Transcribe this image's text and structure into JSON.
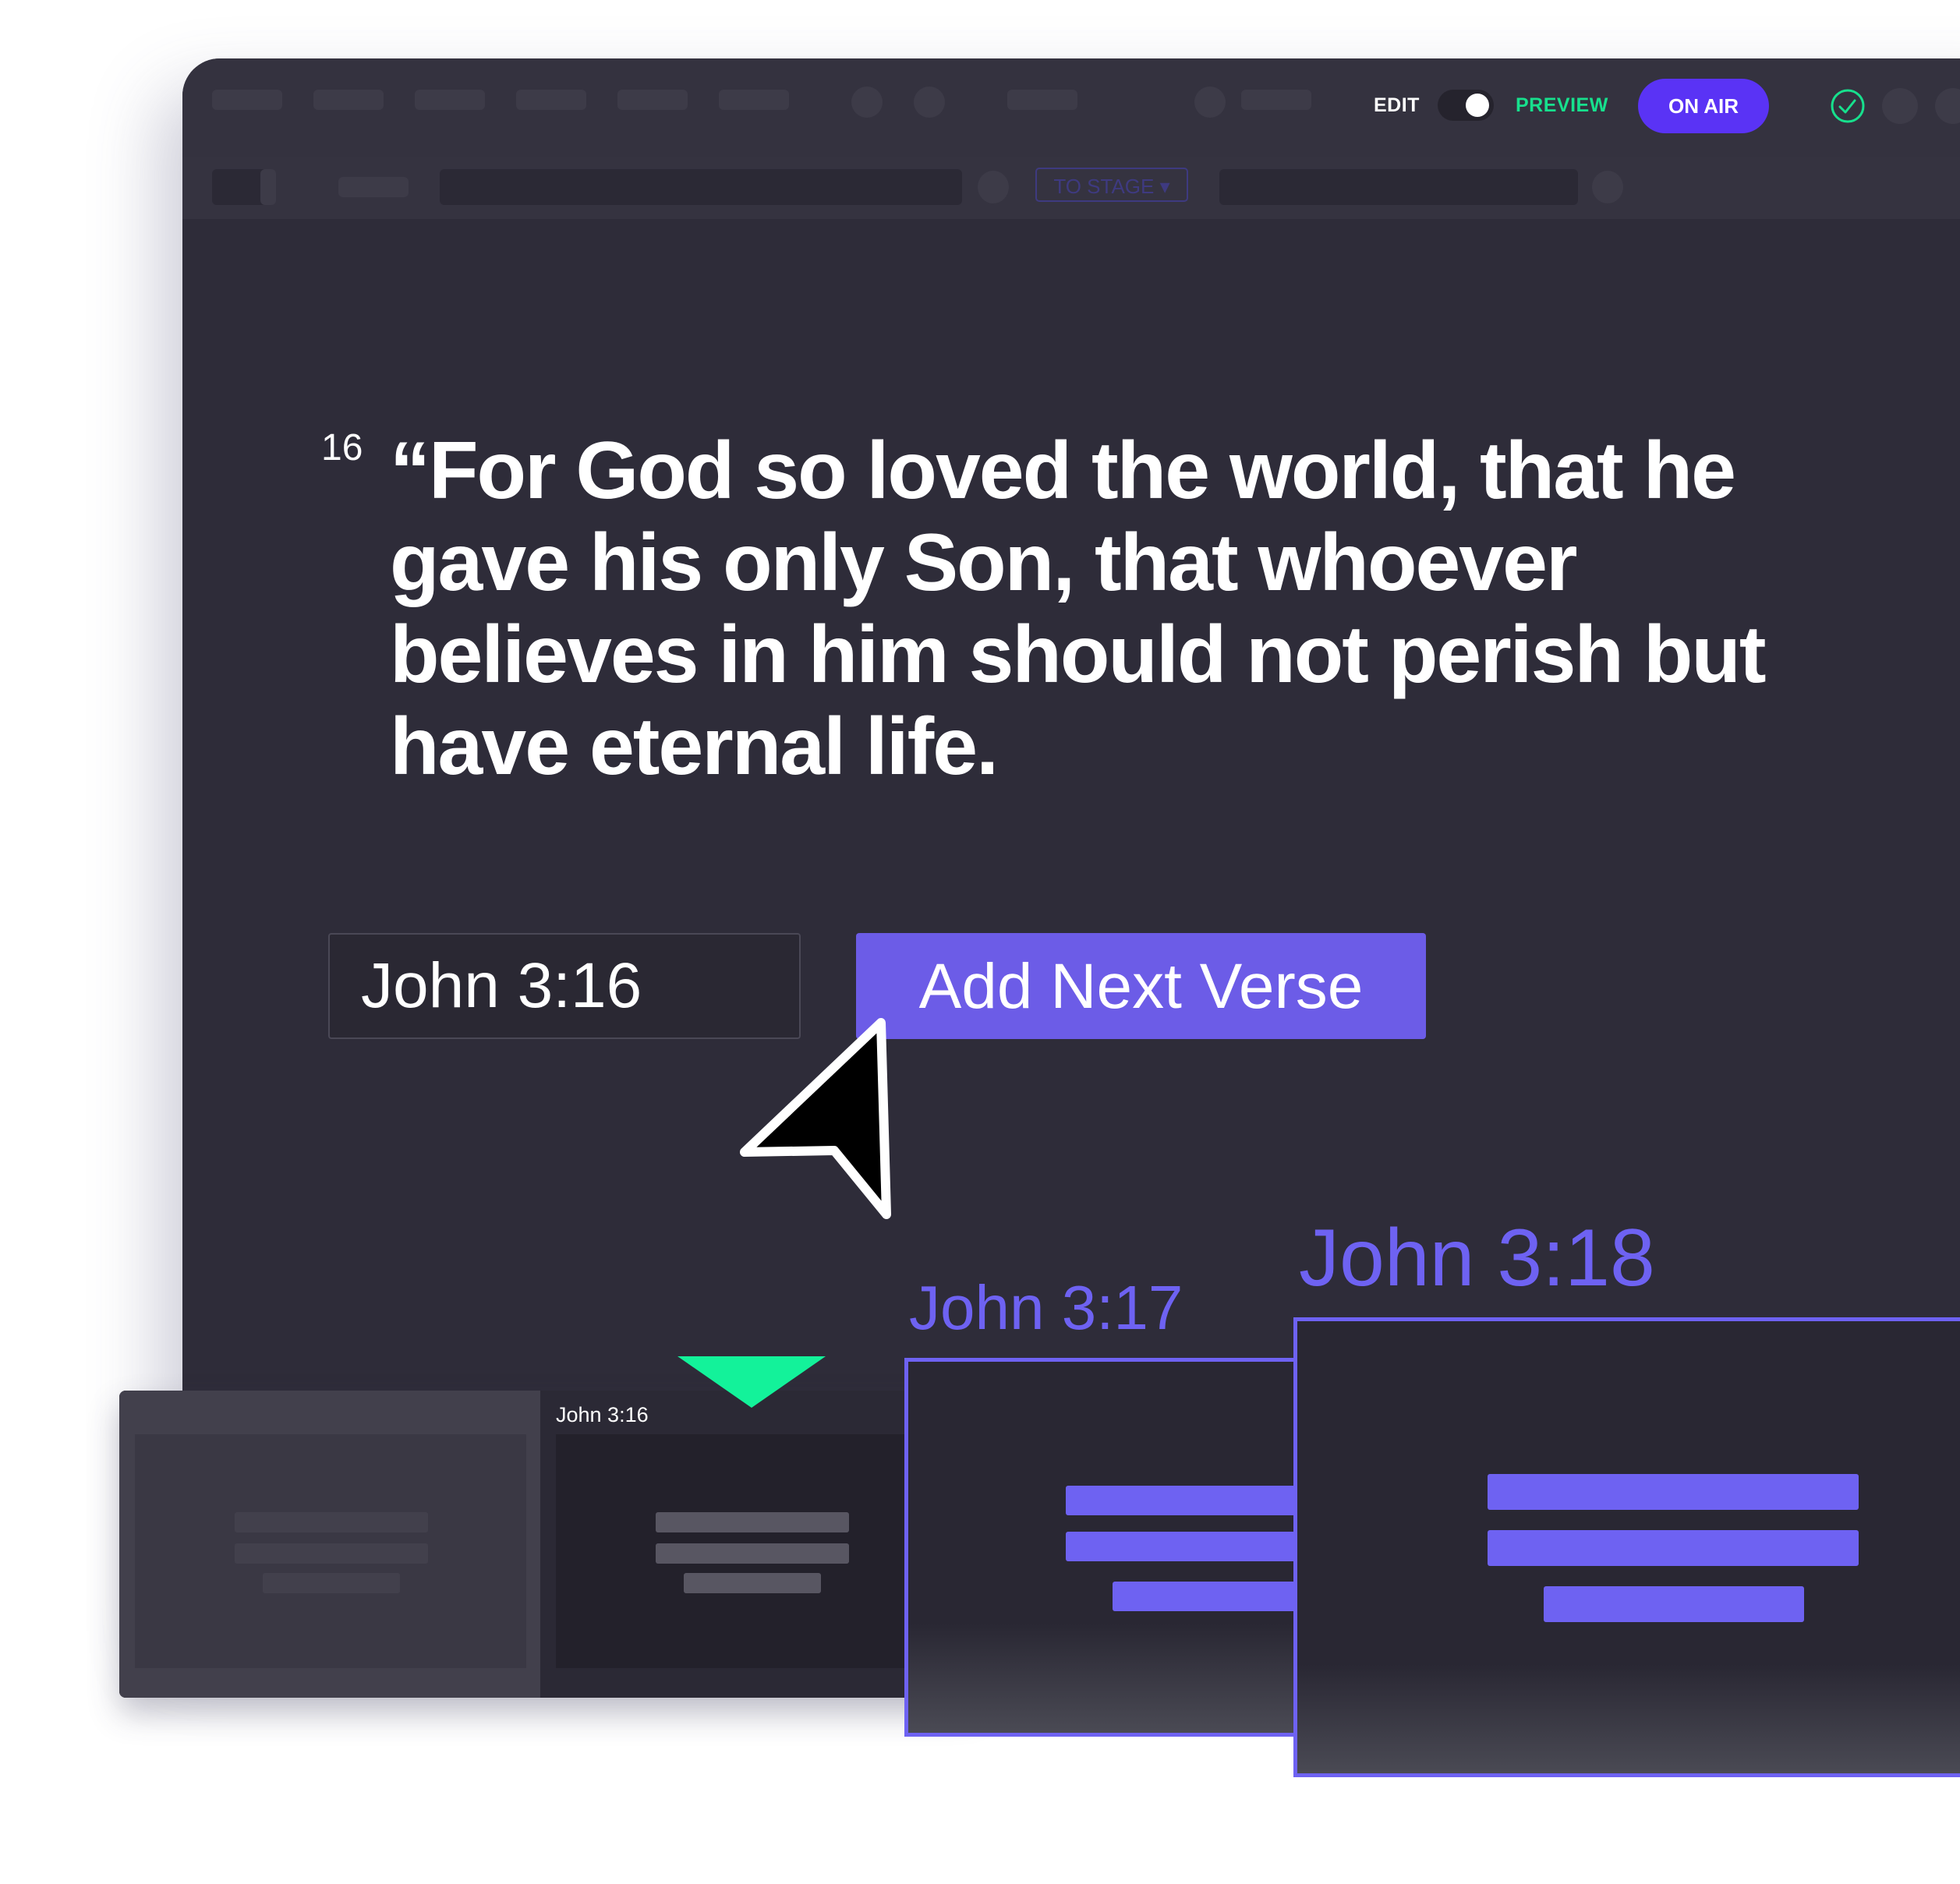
{
  "toolbar": {
    "edit_label": "EDIT",
    "preview_label": "PREVIEW",
    "mode_toggle_state": "preview",
    "on_air_label": "ON AIR",
    "status_icon": "check-circle-icon",
    "to_stage_label": "TO STAGE",
    "to_stage_icon": "caret-down-icon"
  },
  "verse": {
    "number": "16",
    "text": "“For God so loved the world, that he gave his only Son, that whoever believes in him should not perish but have eternal life."
  },
  "reference_input": {
    "value": "John 3:16"
  },
  "add_next_verse_button": {
    "label": "Add Next Verse"
  },
  "slides_panel": {
    "current_slide_title": "John 3:16"
  },
  "incoming_slides": [
    {
      "label": "John 3:17"
    },
    {
      "label": "John 3:18"
    }
  ],
  "colors": {
    "accent": "#6c5ce7",
    "on_air": "#5a33f5",
    "live_green": "#17e08d",
    "background": "#2e2c39"
  }
}
